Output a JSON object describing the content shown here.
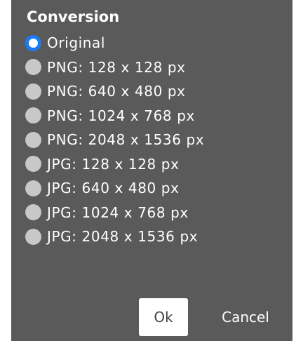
{
  "dialog": {
    "title": "Conversion",
    "selected_index": 0,
    "options": [
      {
        "label": "Original",
        "checked": true
      },
      {
        "label": "PNG: 128 x 128 px",
        "checked": false
      },
      {
        "label": "PNG: 640 x 480 px",
        "checked": false
      },
      {
        "label": "PNG: 1024 x 768 px",
        "checked": false
      },
      {
        "label": "PNG: 2048 x 1536 px",
        "checked": false
      },
      {
        "label": "JPG: 128 x 128 px",
        "checked": false
      },
      {
        "label": "JPG: 640 x 480 px",
        "checked": false
      },
      {
        "label": "JPG: 1024 x 768 px",
        "checked": false
      },
      {
        "label": "JPG: 2048 x 1536 px",
        "checked": false
      }
    ],
    "ok_label": "Ok",
    "cancel_label": "Cancel"
  },
  "colors": {
    "dialog_background": "#5a5a5a",
    "radio_selected_accent": "#1a7cf5",
    "radio_unselected": "#c8c8c8",
    "text": "#ffffff"
  }
}
